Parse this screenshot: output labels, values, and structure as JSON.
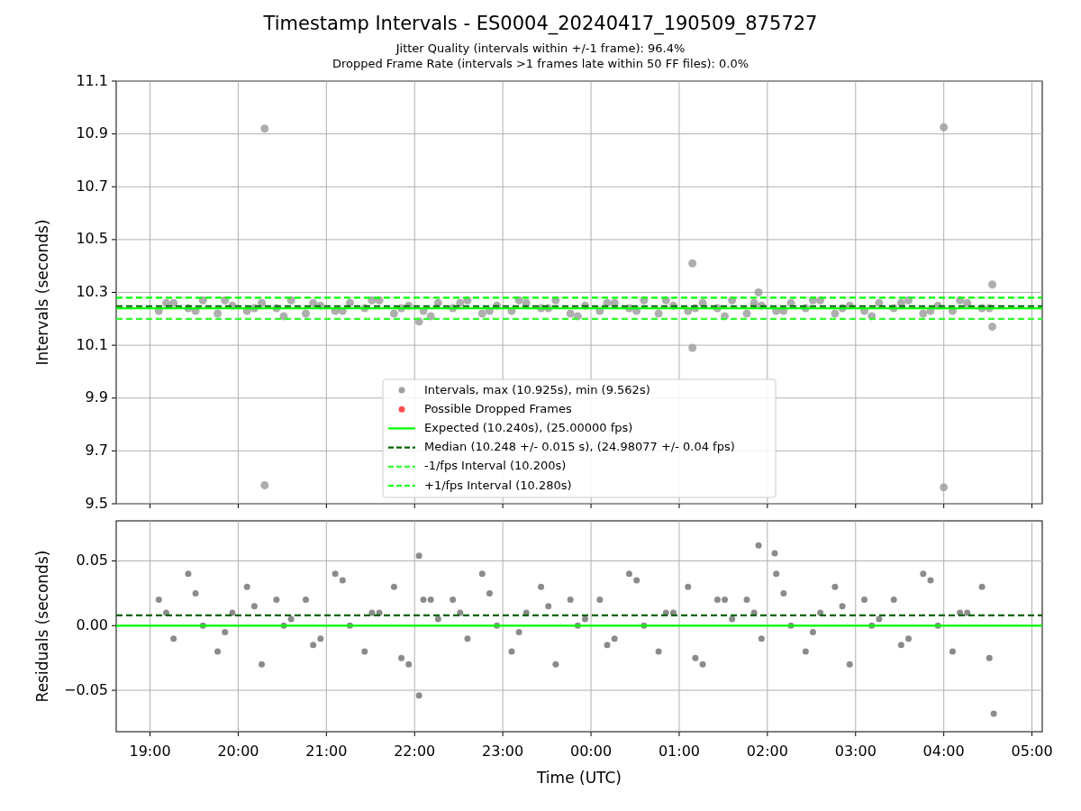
{
  "title": "Timestamp Intervals - ES0004_20240417_190509_875727",
  "subtitles": [
    "Jitter Quality (intervals within +/-1 frame): 96.4%",
    "Dropped Frame Rate (intervals >1 frames late within 50 FF files): 0.0%"
  ],
  "intervals_plot": {
    "chart_data": {
      "type": "scatter",
      "ylabel": "Intervals (seconds)",
      "xlim": [
        "2024-04-17T18:37",
        "2024-04-18T05:07"
      ],
      "ylim": [
        9.5,
        11.1
      ],
      "yticks": [
        {
          "value": 9.5,
          "label": "9.5"
        },
        {
          "value": 9.7,
          "label": "9.7"
        },
        {
          "value": 9.9,
          "label": "9.9"
        },
        {
          "value": 10.1,
          "label": "10.1"
        },
        {
          "value": 10.3,
          "label": "10.3"
        },
        {
          "value": 10.5,
          "label": "10.5"
        },
        {
          "value": 10.7,
          "label": "10.7"
        },
        {
          "value": 10.9,
          "label": "10.9"
        },
        {
          "value": 11.1,
          "label": "11.1"
        }
      ],
      "series": [
        {
          "name": "Intervals, max (10.925s), min (9.562s)",
          "color": "#a0a0a0",
          "x": [
            "2024-04-17T19:06",
            "2024-04-17T19:16",
            "2024-04-17T19:26",
            "2024-04-17T19:36",
            "2024-04-17T19:46",
            "2024-04-17T19:56",
            "2024-04-17T20:06",
            "2024-04-17T20:16",
            "2024-04-17T20:26",
            "2024-04-17T20:36",
            "2024-04-17T20:46",
            "2024-04-17T20:56",
            "2024-04-17T21:06",
            "2024-04-17T21:16",
            "2024-04-17T21:26",
            "2024-04-17T21:36",
            "2024-04-17T21:46",
            "2024-04-17T21:56",
            "2024-04-17T22:06",
            "2024-04-17T22:16",
            "2024-04-17T22:26",
            "2024-04-17T22:36",
            "2024-04-17T22:46",
            "2024-04-17T22:56",
            "2024-04-17T23:06",
            "2024-04-17T23:16",
            "2024-04-17T23:26",
            "2024-04-17T23:36",
            "2024-04-17T23:46",
            "2024-04-17T23:56",
            "2024-04-18T00:06",
            "2024-04-18T00:16",
            "2024-04-18T00:26",
            "2024-04-18T00:36",
            "2024-04-18T00:46",
            "2024-04-18T00:56",
            "2024-04-18T01:06",
            "2024-04-18T01:16",
            "2024-04-18T01:26",
            "2024-04-18T01:36",
            "2024-04-18T01:46",
            "2024-04-18T01:56",
            "2024-04-18T02:06",
            "2024-04-18T02:16",
            "2024-04-18T02:26",
            "2024-04-18T02:36",
            "2024-04-18T02:46",
            "2024-04-18T02:56",
            "2024-04-18T03:06",
            "2024-04-18T03:16",
            "2024-04-18T03:26",
            "2024-04-18T03:36",
            "2024-04-18T03:46",
            "2024-04-18T03:56",
            "2024-04-18T04:06",
            "2024-04-18T04:16",
            "2024-04-18T04:26",
            "2024-04-17T19:11",
            "2024-04-17T19:31",
            "2024-04-17T19:51",
            "2024-04-17T20:11",
            "2024-04-17T20:31",
            "2024-04-17T20:51",
            "2024-04-17T21:11",
            "2024-04-17T21:31",
            "2024-04-17T21:51",
            "2024-04-17T22:11",
            "2024-04-17T22:31",
            "2024-04-17T22:51",
            "2024-04-17T23:11",
            "2024-04-17T23:31",
            "2024-04-17T23:51",
            "2024-04-18T00:11",
            "2024-04-18T00:31",
            "2024-04-18T00:51",
            "2024-04-18T01:11",
            "2024-04-18T01:31",
            "2024-04-18T01:51",
            "2024-04-18T02:11",
            "2024-04-18T02:31",
            "2024-04-18T02:51",
            "2024-04-18T03:11",
            "2024-04-18T03:31",
            "2024-04-18T03:51",
            "2024-04-18T04:11",
            "2024-04-18T04:31",
            "2024-04-17T20:18",
            "2024-04-17T20:18",
            "2024-04-18T01:09",
            "2024-04-18T01:09",
            "2024-04-18T01:54",
            "2024-04-18T04:00",
            "2024-04-18T04:00",
            "2024-04-18T04:33",
            "2024-04-18T04:33",
            "2024-04-17T22:03"
          ],
          "values": [
            10.23,
            10.26,
            10.24,
            10.27,
            10.22,
            10.25,
            10.23,
            10.26,
            10.24,
            10.27,
            10.22,
            10.25,
            10.23,
            10.26,
            10.24,
            10.27,
            10.22,
            10.25,
            10.23,
            10.26,
            10.24,
            10.27,
            10.22,
            10.25,
            10.23,
            10.26,
            10.24,
            10.27,
            10.22,
            10.25,
            10.23,
            10.26,
            10.24,
            10.27,
            10.22,
            10.25,
            10.23,
            10.26,
            10.24,
            10.27,
            10.22,
            10.25,
            10.23,
            10.26,
            10.24,
            10.27,
            10.22,
            10.25,
            10.23,
            10.26,
            10.24,
            10.27,
            10.22,
            10.25,
            10.23,
            10.26,
            10.24,
            10.26,
            10.23,
            10.27,
            10.24,
            10.21,
            10.26,
            10.23,
            10.27,
            10.24,
            10.21,
            10.26,
            10.23,
            10.27,
            10.24,
            10.21,
            10.26,
            10.23,
            10.27,
            10.24,
            10.21,
            10.26,
            10.23,
            10.27,
            10.24,
            10.21,
            10.26,
            10.23,
            10.27,
            10.24,
            10.92,
            9.57,
            10.41,
            10.09,
            10.3,
            10.925,
            9.562,
            10.33,
            10.17,
            10.19
          ]
        },
        {
          "name": "Possible Dropped Frames",
          "color": "#ff5050"
        }
      ],
      "ref_lines": [
        {
          "axis": "y",
          "value": 10.24,
          "label": "Expected (10.240s), (25.00000 fps)",
          "color": "#00ff00"
        },
        {
          "axis": "y",
          "value": 10.248,
          "label": "Median (10.248 +/- 0.015 s), (24.98077 +/- 0.04 fps)",
          "color": "#006400"
        },
        {
          "axis": "y",
          "value": 10.2,
          "label": "-1/fps Interval (10.200s)",
          "color": "#33ff33"
        },
        {
          "axis": "y",
          "value": 10.28,
          "label": "+1/fps Interval (10.280s)",
          "color": "#00ff00"
        }
      ],
      "grid": true,
      "legend": "lower center"
    }
  },
  "residuals_plot": {
    "chart_data": {
      "type": "scatter",
      "xlabel": "Time (UTC)",
      "ylabel": "Residuals (seconds)",
      "xlim": [
        "2024-04-17T18:37",
        "2024-04-18T05:07"
      ],
      "ylim": [
        -0.082,
        0.081
      ],
      "xticks": [
        {
          "value": "2024-04-17T19:00",
          "label": "19:00"
        },
        {
          "value": "2024-04-17T20:00",
          "label": "20:00"
        },
        {
          "value": "2024-04-17T21:00",
          "label": "21:00"
        },
        {
          "value": "2024-04-17T22:00",
          "label": "22:00"
        },
        {
          "value": "2024-04-17T23:00",
          "label": "23:00"
        },
        {
          "value": "2024-04-18T00:00",
          "label": "00:00"
        },
        {
          "value": "2024-04-18T01:00",
          "label": "01:00"
        },
        {
          "value": "2024-04-18T02:00",
          "label": "02:00"
        },
        {
          "value": "2024-04-18T03:00",
          "label": "03:00"
        },
        {
          "value": "2024-04-18T04:00",
          "label": "04:00"
        },
        {
          "value": "2024-04-18T05:00",
          "label": "05:00"
        }
      ],
      "yticks": [
        {
          "value": 0.05,
          "label": "0.05"
        },
        {
          "value": 0,
          "label": "0.00"
        },
        {
          "value": -0.05,
          "label": "−0.05"
        }
      ],
      "series": [
        {
          "color": "#777777",
          "x": [
            "2024-04-17T19:06",
            "2024-04-17T19:16",
            "2024-04-17T19:26",
            "2024-04-17T19:36",
            "2024-04-17T19:46",
            "2024-04-17T19:56",
            "2024-04-17T20:06",
            "2024-04-17T20:16",
            "2024-04-17T20:26",
            "2024-04-17T20:36",
            "2024-04-17T20:46",
            "2024-04-17T20:56",
            "2024-04-17T21:06",
            "2024-04-17T21:16",
            "2024-04-17T21:26",
            "2024-04-17T21:36",
            "2024-04-17T21:46",
            "2024-04-17T21:56",
            "2024-04-17T22:06",
            "2024-04-17T22:16",
            "2024-04-17T22:26",
            "2024-04-17T22:36",
            "2024-04-17T22:46",
            "2024-04-17T22:56",
            "2024-04-17T23:06",
            "2024-04-17T23:16",
            "2024-04-17T23:26",
            "2024-04-17T23:36",
            "2024-04-17T23:46",
            "2024-04-17T23:56",
            "2024-04-18T00:06",
            "2024-04-18T00:16",
            "2024-04-18T00:26",
            "2024-04-18T00:36",
            "2024-04-18T00:46",
            "2024-04-18T00:56",
            "2024-04-18T01:06",
            "2024-04-18T01:16",
            "2024-04-18T01:26",
            "2024-04-18T01:36",
            "2024-04-18T01:46",
            "2024-04-18T01:56",
            "2024-04-18T02:06",
            "2024-04-18T02:16",
            "2024-04-18T02:26",
            "2024-04-18T02:36",
            "2024-04-18T02:46",
            "2024-04-18T02:56",
            "2024-04-18T03:06",
            "2024-04-18T03:16",
            "2024-04-18T03:26",
            "2024-04-18T03:36",
            "2024-04-18T03:46",
            "2024-04-18T03:56",
            "2024-04-18T04:06",
            "2024-04-18T04:16",
            "2024-04-18T04:26",
            "2024-04-17T19:11",
            "2024-04-17T19:31",
            "2024-04-17T19:51",
            "2024-04-17T20:11",
            "2024-04-17T20:31",
            "2024-04-17T20:51",
            "2024-04-17T21:11",
            "2024-04-17T21:31",
            "2024-04-17T21:51",
            "2024-04-17T22:11",
            "2024-04-17T22:31",
            "2024-04-17T22:51",
            "2024-04-17T23:11",
            "2024-04-17T23:31",
            "2024-04-17T23:51",
            "2024-04-18T00:11",
            "2024-04-18T00:31",
            "2024-04-18T00:51",
            "2024-04-18T01:11",
            "2024-04-18T01:31",
            "2024-04-18T01:51",
            "2024-04-18T02:11",
            "2024-04-18T02:31",
            "2024-04-18T02:51",
            "2024-04-18T03:11",
            "2024-04-18T03:31",
            "2024-04-18T03:51",
            "2024-04-18T04:11",
            "2024-04-18T04:31",
            "2024-04-17T22:03",
            "2024-04-17T22:03",
            "2024-04-18T01:54",
            "2024-04-18T02:05",
            "2024-04-18T04:34"
          ],
          "values": [
            0.02,
            -0.01,
            0.04,
            0.0,
            -0.02,
            0.01,
            0.03,
            -0.03,
            0.02,
            0.005,
            0.02,
            -0.01,
            0.04,
            0.0,
            -0.02,
            0.01,
            0.03,
            -0.03,
            0.02,
            0.005,
            0.02,
            -0.01,
            0.04,
            0.0,
            -0.02,
            0.01,
            0.03,
            -0.03,
            0.02,
            0.005,
            0.02,
            -0.01,
            0.04,
            0.0,
            -0.02,
            0.01,
            0.03,
            -0.03,
            0.02,
            0.005,
            0.02,
            -0.01,
            0.04,
            0.0,
            -0.02,
            0.01,
            0.03,
            -0.03,
            0.02,
            0.005,
            0.02,
            -0.01,
            0.04,
            0.0,
            -0.02,
            0.01,
            0.03,
            0.01,
            0.025,
            -0.005,
            0.015,
            0.0,
            -0.015,
            0.035,
            0.01,
            -0.025,
            0.02,
            0.01,
            0.025,
            -0.005,
            0.015,
            0.0,
            -0.015,
            0.035,
            0.01,
            -0.025,
            0.02,
            0.01,
            0.025,
            -0.005,
            0.015,
            0.0,
            -0.015,
            0.035,
            0.01,
            -0.025,
            -0.054,
            0.054,
            0.062,
            0.056,
            -0.068
          ]
        }
      ],
      "ref_lines": [
        {
          "axis": "y",
          "value": 0.008,
          "color": "#006400"
        },
        {
          "axis": "y",
          "value": 0,
          "color": "#00ff00"
        }
      ],
      "grid": true
    }
  }
}
